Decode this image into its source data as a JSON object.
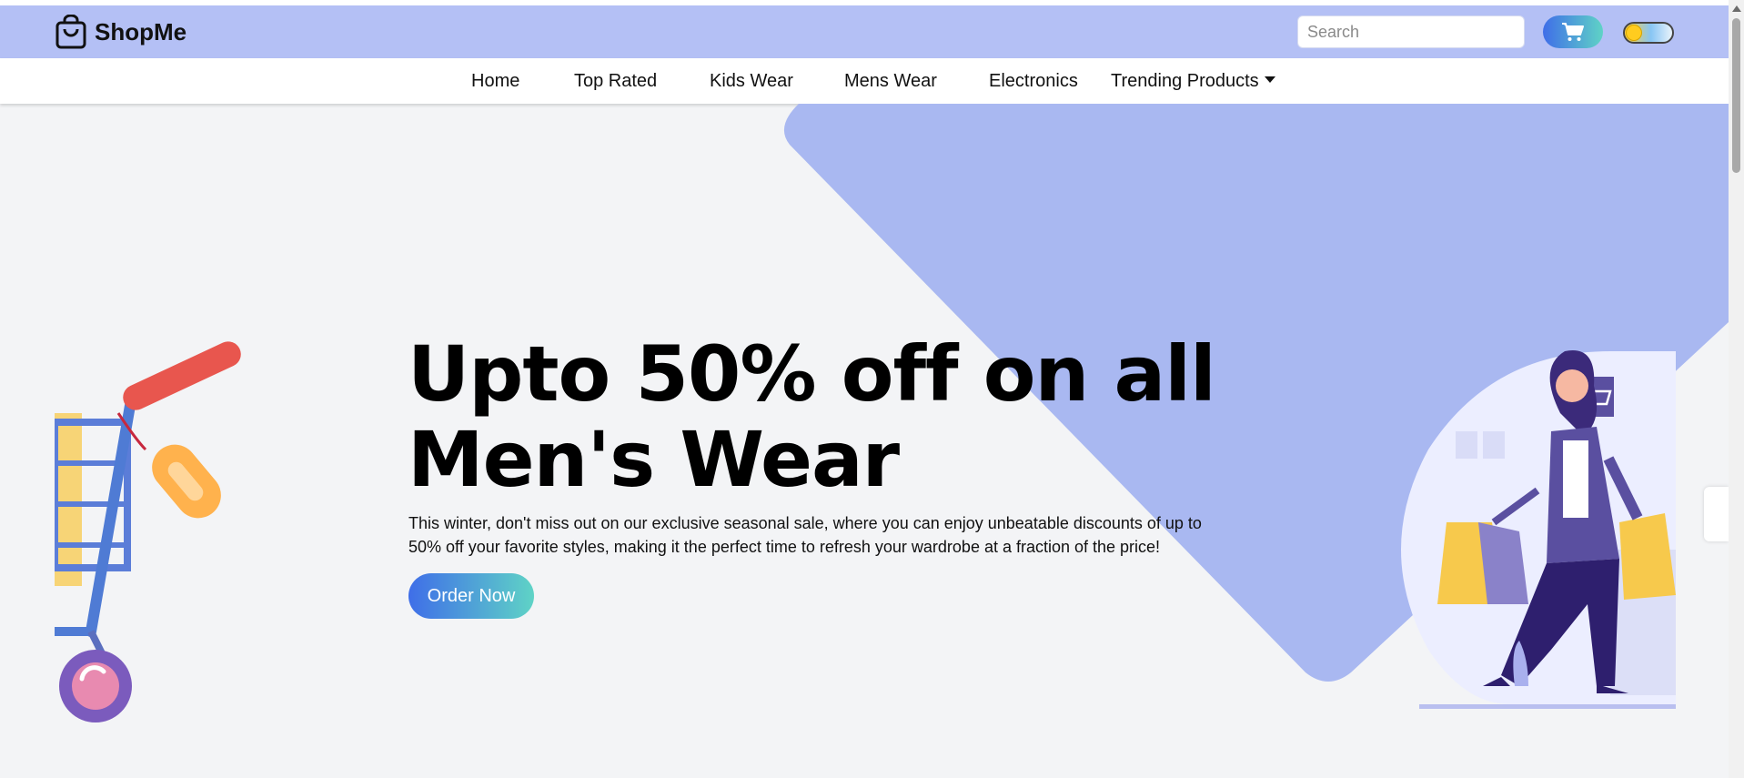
{
  "header": {
    "logo_icon": "shopping-bag-icon",
    "logo_text": "ShopMe",
    "search_placeholder": "Search",
    "search_icon": "search-icon",
    "cart_icon": "cart-icon",
    "theme_toggle_icon": "sun-toggle-icon",
    "header_color": "#b4c0f5"
  },
  "nav": {
    "items": [
      {
        "label": "Home"
      },
      {
        "label": "Top Rated"
      },
      {
        "label": "Kids Wear"
      },
      {
        "label": "Mens Wear"
      },
      {
        "label": "Electronics"
      },
      {
        "label": "Trending Products",
        "icon": "caret-down-icon"
      }
    ]
  },
  "hero": {
    "headline": "Upto 50% off on all Men's Wear",
    "description": "This winter, don't miss out on our exclusive seasonal sale, where you can enjoy unbeatable discounts of up to 50% off your favorite styles, making it the perfect time to refresh your wardrobe at a fraction of the price!",
    "cta_label": "Order Now",
    "accent_gradient_start": "#3f6ee8",
    "accent_gradient_end": "#5fd3c6",
    "shape_color": "#a9b8f1"
  }
}
